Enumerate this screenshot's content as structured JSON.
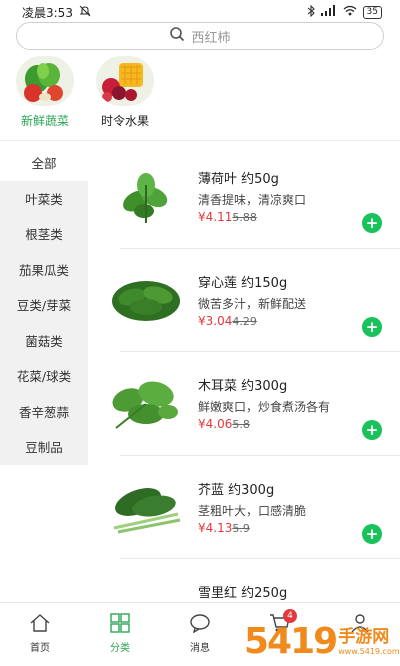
{
  "status_bar": {
    "time": "凌晨3:53",
    "battery": "35"
  },
  "search": {
    "placeholder": "西红柿"
  },
  "top_categories": [
    {
      "label": "新鲜蔬菜",
      "active": true
    },
    {
      "label": "时令水果",
      "active": false
    }
  ],
  "sidebar": {
    "items": [
      "全部",
      "叶菜类",
      "根茎类",
      "茄果瓜类",
      "豆类/芽菜",
      "菌菇类",
      "花菜/球类",
      "香辛葱蒜",
      "豆制品"
    ],
    "active_index": 0
  },
  "products": [
    {
      "name": "薄荷叶 约50g",
      "desc": "清香提味，清凉爽口",
      "price": "¥4.11",
      "old_price": "5.88"
    },
    {
      "name": "穿心莲 约150g",
      "desc": "微苦多汁，新鲜配送",
      "price": "¥3.04",
      "old_price": "4.29"
    },
    {
      "name": "木耳菜 约300g",
      "desc": "鲜嫩爽口，炒食煮汤各有",
      "price": "¥4.06",
      "old_price": "5.8"
    },
    {
      "name": "芥蓝 约300g",
      "desc": "茎粗叶大，口感清脆",
      "price": "¥4.13",
      "old_price": "5.9"
    },
    {
      "name": "雪里红 约250g",
      "desc": "",
      "price": "",
      "old_price": ""
    }
  ],
  "bottom_nav": [
    {
      "label": "首页",
      "icon": "home-icon"
    },
    {
      "label": "分类",
      "icon": "grid-icon",
      "active": true
    },
    {
      "label": "消息",
      "icon": "chat-icon"
    },
    {
      "label": "",
      "icon": "cart-icon",
      "badge": "4"
    },
    {
      "label": "",
      "icon": "user-icon"
    }
  ],
  "watermark": {
    "number": "5419",
    "text": "手游网",
    "sub": "www.5419.com"
  },
  "colors": {
    "accent": "#2aa552",
    "price": "#e4393c",
    "add_button": "#19c25a"
  }
}
